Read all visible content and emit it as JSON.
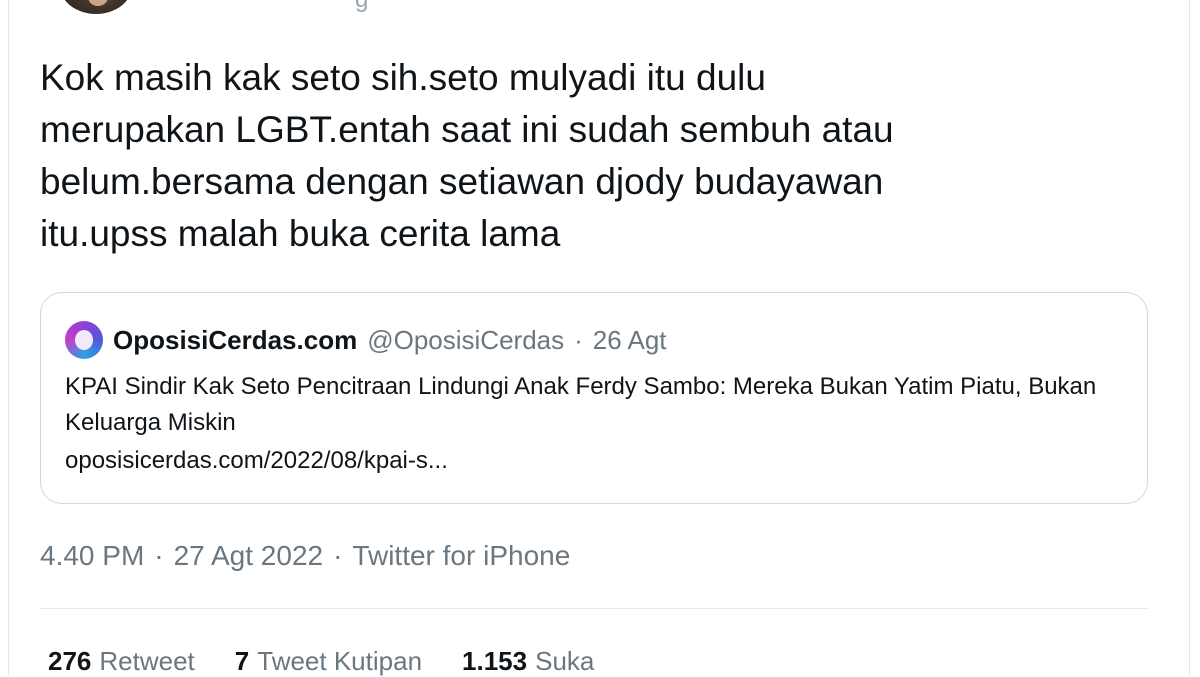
{
  "tweet": {
    "text": "Kok masih kak seto sih.seto mulyadi itu dulu\nmerupakan LGBT.entah saat ini sudah sembuh atau\nbelum.bersama dengan setiawan djody budayawan\nitu.upss malah buka cerita lama"
  },
  "quote": {
    "name": "OposisiCerdas.com",
    "handle": "@OposisiCerdas",
    "separator": "·",
    "date": "26 Agt",
    "text": "KPAI Sindir Kak Seto Pencitraan Lindungi Anak Ferdy Sambo: Mereka Bukan Yatim Piatu, Bukan Keluarga Miskin",
    "link": "oposisicerdas.com/2022/08/kpai-s..."
  },
  "meta": {
    "time": "4.40 PM",
    "sep1": "·",
    "date": "27 Agt 2022",
    "sep2": "·",
    "source": "Twitter for iPhone"
  },
  "stats": {
    "retweets": {
      "count": "276",
      "label": "Retweet"
    },
    "quotes": {
      "count": "7",
      "label": "Tweet Kutipan"
    },
    "likes": {
      "count": "1.153",
      "label": "Suka"
    }
  }
}
